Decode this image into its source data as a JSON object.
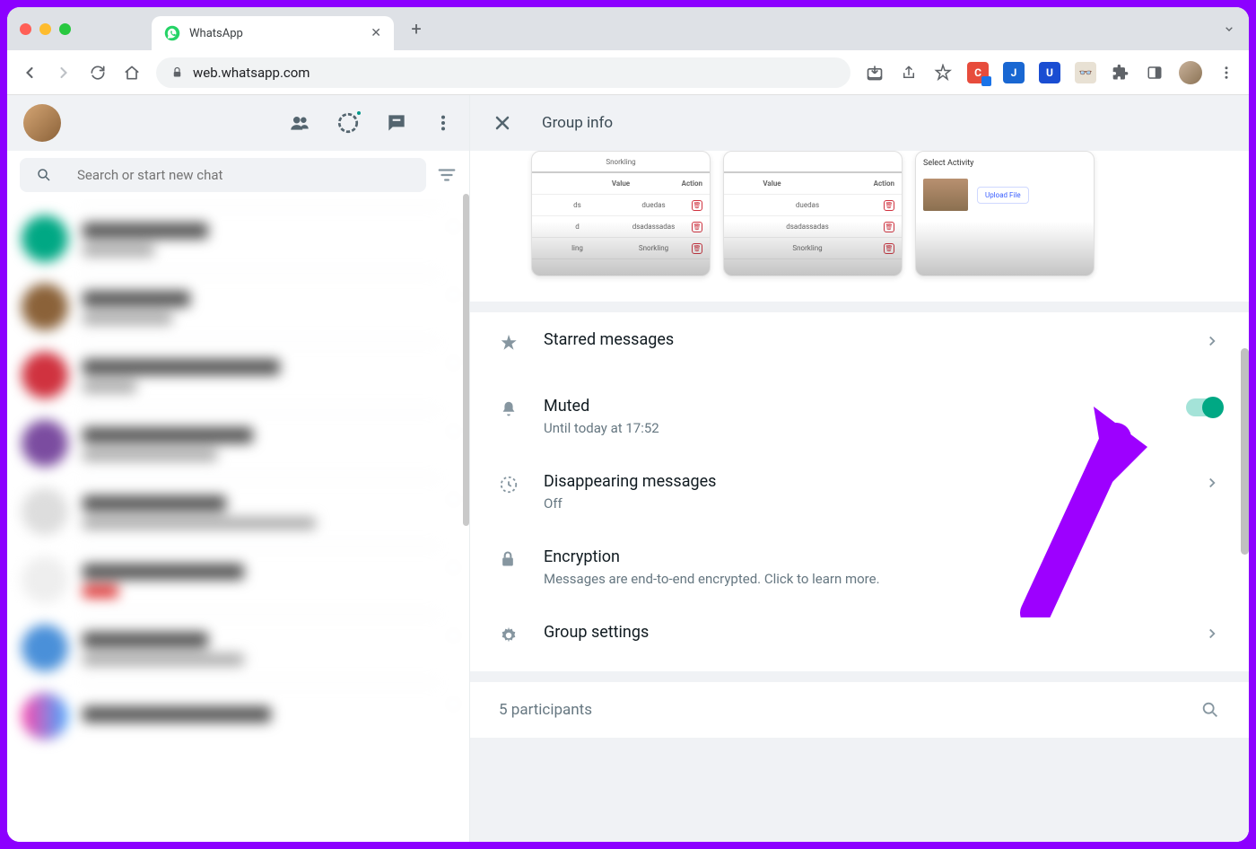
{
  "browser": {
    "tab_title": "WhatsApp",
    "url": "web.whatsapp.com"
  },
  "sidebar": {
    "search_placeholder": "Search or start new chat"
  },
  "panel": {
    "title": "Group info",
    "media": {
      "thumbs": [
        {
          "header": "Snorkling",
          "col_value": "Value",
          "col_action": "Action",
          "rows": [
            "duedas",
            "dsadassadas",
            "Snorkling"
          ]
        },
        {
          "header": "",
          "col_value": "Value",
          "col_action": "Action",
          "rows": [
            "duedas",
            "dsadassadas",
            "Snorkling"
          ]
        },
        {
          "select_label": "Select Activity",
          "upload_label": "Upload File"
        }
      ]
    },
    "settings": {
      "starred": {
        "title": "Starred messages"
      },
      "muted": {
        "title": "Muted",
        "sub": "Until today at 17:52",
        "toggle_on": true
      },
      "disappearing": {
        "title": "Disappearing messages",
        "sub": "Off"
      },
      "encryption": {
        "title": "Encryption",
        "sub": "Messages are end-to-end encrypted. Click to learn more."
      },
      "group_settings": {
        "title": "Group settings"
      }
    },
    "participants": {
      "text": "5 participants"
    }
  }
}
